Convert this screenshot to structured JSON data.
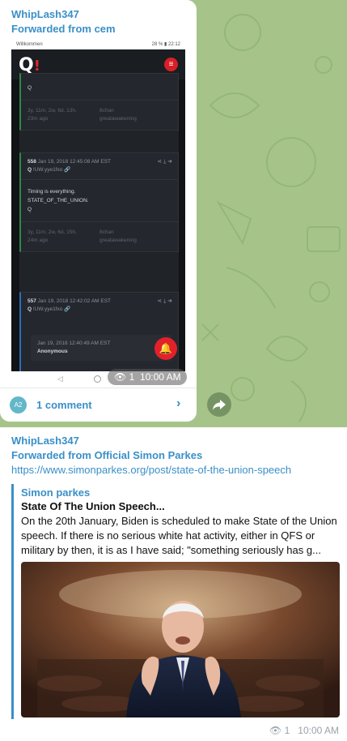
{
  "message1": {
    "sender": "WhipLash347",
    "forwarded": "Forwarded from cem",
    "screenshot": {
      "status_left": "Willkommen",
      "status_right": "28 % ▮ 22:12",
      "cards": [
        {
          "body_line": "Q",
          "meta_left_1": "3y, 11m, 2w, 6d, 13h,",
          "meta_left_2": "23m ago",
          "meta_right_1": "8chan",
          "meta_right_2": "greatawakening"
        },
        {
          "id": "558",
          "date": "Jan 19, 2018 12:45:08 AM EST",
          "author": "Q",
          "trip": "!UW.yye1fxo",
          "lines": [
            "Timing is everything.",
            "STATE_OF_THE_UNION.",
            "Q"
          ],
          "meta_left_1": "3y, 11m, 2w, 6d, 15h,",
          "meta_left_2": "24m ago",
          "meta_right_1": "8chan",
          "meta_right_2": "greatawakening"
        },
        {
          "id": "557",
          "date": "Jan 19, 2018 12:42:02 AM EST",
          "author": "Q",
          "trip": "!UW.yye1fxo",
          "reply_date": "Jan 19, 2018 12:40:49 AM EST",
          "reply_author": "Anonymous"
        }
      ]
    },
    "views": "1",
    "time": "10:00 AM",
    "avatar_initials": "A2",
    "comments_label": "1 comment"
  },
  "message2": {
    "sender": "WhipLash347",
    "forwarded": "Forwarded from Official Simon Parkes",
    "url": "https://www.simonparkes.org/post/state-of-the-union-speech",
    "preview": {
      "site": "Simon parkes",
      "title": "State Of The Union Speech...",
      "description": "On the 20th January, Biden is scheduled to make State of the Union speech. If there is no serious white hat activity, either in QFS or military by then, it is as I have said; \"something seriously has g..."
    },
    "views": "1",
    "time": "10:00 AM"
  },
  "colors": {
    "accent": "#3a8fc8",
    "chat_background": "#a6c48a",
    "q_red": "#e0262c"
  }
}
